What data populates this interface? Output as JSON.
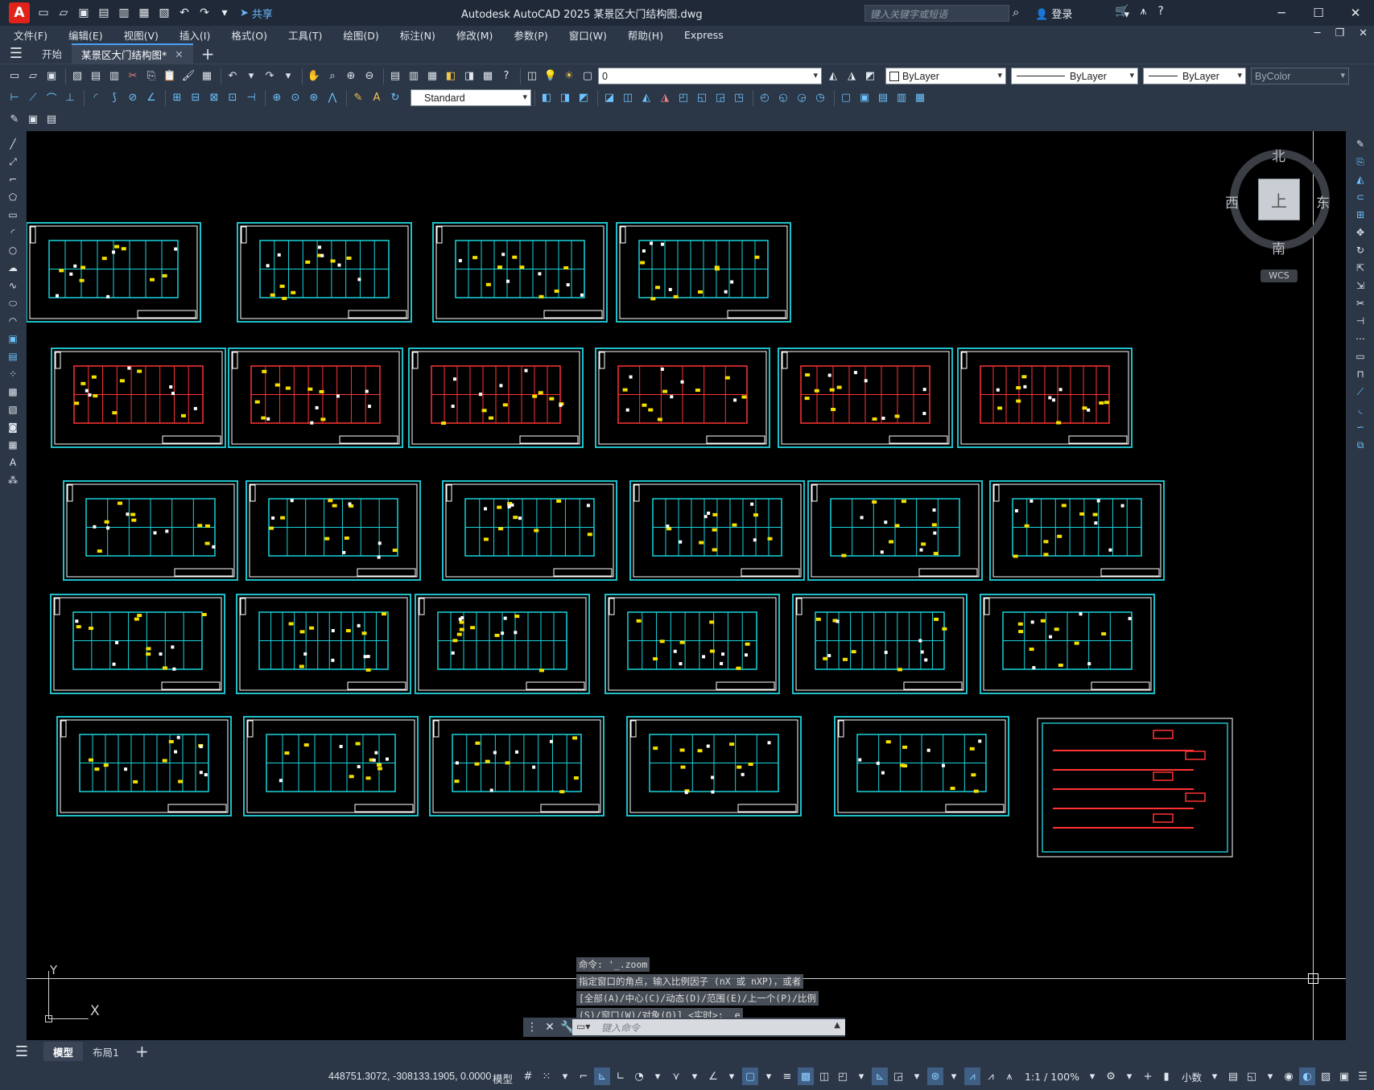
{
  "titlebar": {
    "title": "Autodesk AutoCAD 2025    某景区大门结构图.dwg",
    "logo": "A",
    "share_label": "共享",
    "search_placeholder": "键入关键字或短语",
    "login_label": "登录"
  },
  "menu": [
    "文件(F)",
    "编辑(E)",
    "视图(V)",
    "插入(I)",
    "格式(O)",
    "工具(T)",
    "绘图(D)",
    "标注(N)",
    "修改(M)",
    "参数(P)",
    "窗口(W)",
    "帮助(H)",
    "Express"
  ],
  "tabs": {
    "start_label": "开始",
    "document_label": "某景区大门结构图*"
  },
  "toolbar": {
    "layer_value": "0",
    "text_style": "Standard",
    "color_value": "ByLayer",
    "linetype_value": "ByLayer",
    "lineweight_value": "ByLayer",
    "plotstyle_value": "ByColor"
  },
  "viewcube": {
    "north": "北",
    "south": "南",
    "east": "东",
    "west": "西",
    "face": "上",
    "wcs_label": "WCS"
  },
  "ucs": {
    "x_label": "X",
    "y_label": "Y"
  },
  "command": {
    "history": [
      "命令: '_.zoom",
      "指定窗口的角点，输入比例因子 (nX 或 nXP)，或者",
      "[全部(A)/中心(C)/动态(D)/范围(E)/上一个(P)/比例",
      "(S)/窗口(W)/对象(O)] <实时>: _e"
    ],
    "input_placeholder": "键入命令"
  },
  "layout_tabs": {
    "model_label": "模型",
    "layout1_label": "布局1"
  },
  "status": {
    "coordinates": "448751.3072, -308133.1905, 0.0000",
    "model_label": "模型",
    "scale_label": "1:1 / 100%",
    "units_label": "小数"
  },
  "colors": {
    "canvas": "#000000",
    "sheet_border": "#1fbfc9",
    "accent": "#4aa1f3",
    "logo_red": "#e2231a"
  }
}
